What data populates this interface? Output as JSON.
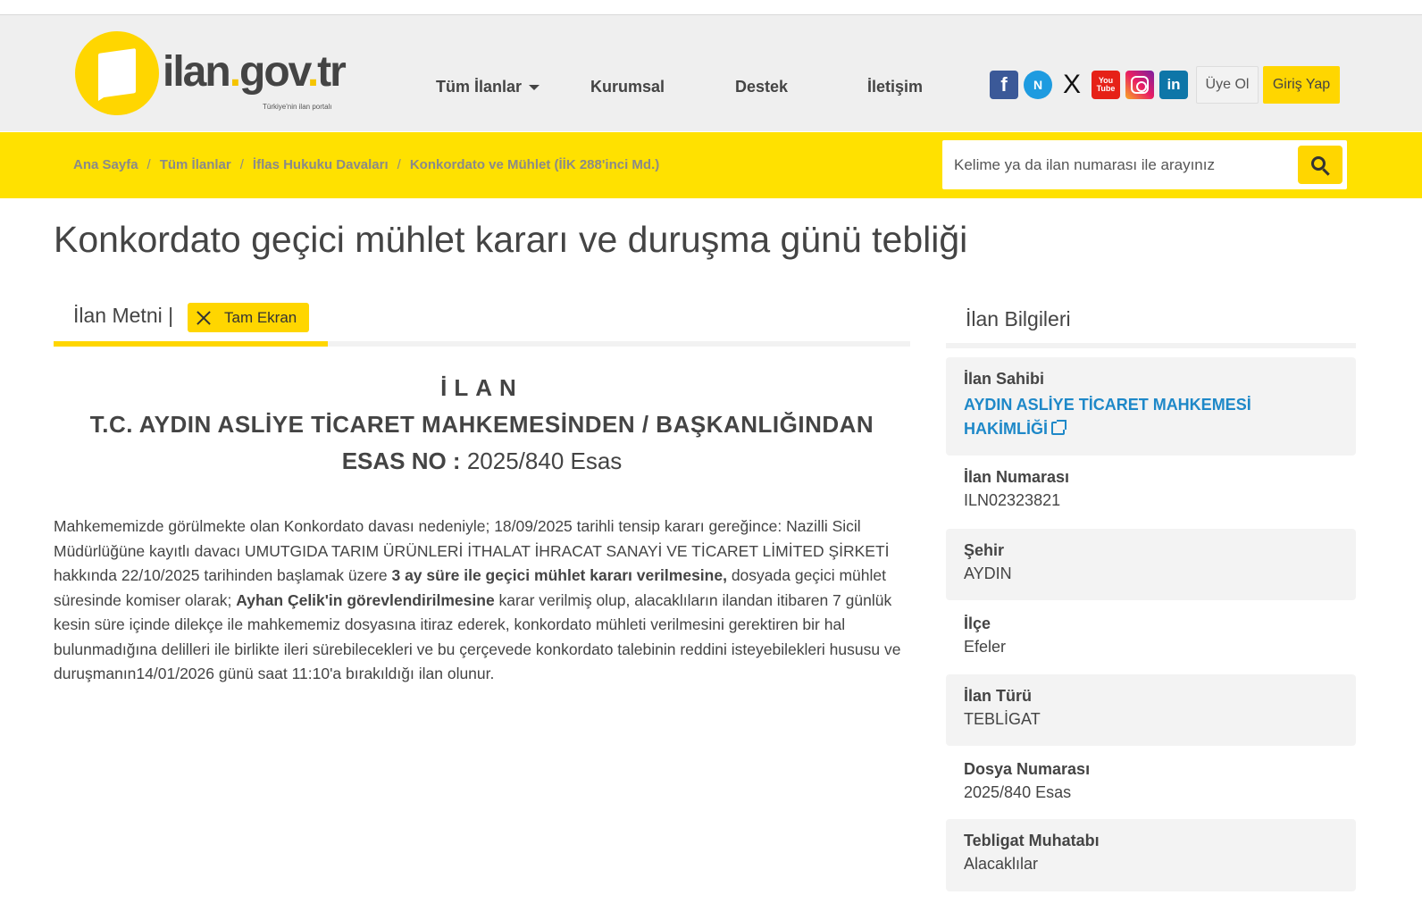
{
  "site": {
    "logo_text_a": "ilan",
    "logo_text_dot": ".",
    "logo_text_b": "gov",
    "logo_text_dot2": ".",
    "logo_text_c": "tr",
    "logo_tagline": "Türkiye'nin ilan portalı"
  },
  "nav": {
    "items": [
      {
        "label": "Tüm İlanlar"
      },
      {
        "label": "Kurumsal"
      },
      {
        "label": "Destek"
      },
      {
        "label": "İletişim"
      }
    ],
    "uye_ol": "Üye Ol",
    "giris_yap": "Giriş Yap"
  },
  "social": {
    "facebook": "f",
    "nv": "N",
    "x": "X",
    "youtube_top": "You",
    "youtube_bottom": "Tube",
    "linkedin": "in"
  },
  "breadcrumb": [
    "Ana Sayfa",
    "Tüm İlanlar",
    "İflas Hukuku Davaları",
    "Konkordato ve Mühlet (İİK 288'inci Md.)"
  ],
  "search": {
    "placeholder": "Kelime ya da ilan numarası ile arayınız"
  },
  "page_title": "Konkordato geçici mühlet kararı ve duruşma günü tebliği",
  "tabs": {
    "ilan_metni": "İlan Metni |",
    "tam_ekran": "Tam Ekran"
  },
  "document": {
    "h1": "İLAN",
    "h2": "T.C. AYDIN ASLİYE TİCARET MAHKEMESİNDEN / BAŞKANLIĞINDAN",
    "h3_label": "ESAS NO :",
    "h3_value": " 2025/840 Esas",
    "p1": "Mahkememizde görülmekte olan Konkordato davası nedeniyle; 18/09/2025 tarihli tensip kararı gereğince: Nazilli Sicil Müdürlüğüne kayıtlı davacı UMUTGIDA TARIM ÜRÜNLERİ İTHALAT İHRACAT SANAYİ VE TİCARET LİMİTED ŞİRKETİ hakkında 22/10/2025 tarihinden başlamak üzere ",
    "b1": "3 ay süre ile geçici mühlet kararı verilmesine,",
    "p2": " dosyada geçici mühlet süresinde komiser olarak; ",
    "b2": "Ayhan Çelik'in görevlendirilmesine",
    "p3": " karar verilmiş olup, alacaklıların ilandan itibaren 7 günlük kesin süre içinde dilekçe ile mahkememiz dosyasına itiraz ederek, konkordato mühleti verilmesini gerektiren bir hal bulunmadığına delilleri ile birlikte ileri sürebilecekleri ve bu çerçevede konkordato talebinin reddini isteyebilekleri hususu ve duruşmanın14/01/2026 günü saat 11:10'a bırakıldığı ilan olunur."
  },
  "sidebar": {
    "title": "İlan Bilgileri",
    "owner_label": "İlan Sahibi",
    "owner_line1": "AYDIN ASLİYE TİCARET MAHKEMESİ",
    "owner_line2": "HAKİMLİĞİ",
    "fields": [
      {
        "label": "İlan Numarası",
        "value": "ILN02323821"
      },
      {
        "label": "Şehir",
        "value": "AYDIN"
      },
      {
        "label": "İlçe",
        "value": "Efeler"
      },
      {
        "label": "İlan Türü",
        "value": "TEBLİGAT"
      },
      {
        "label": "Dosya Numarası",
        "value": "2025/840 Esas"
      },
      {
        "label": "Tebligat Muhatabı",
        "value": "Alacaklılar"
      }
    ]
  }
}
